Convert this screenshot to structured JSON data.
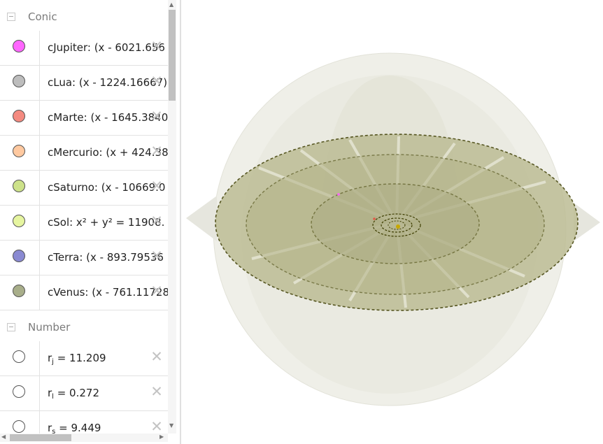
{
  "algebra": {
    "groups": [
      {
        "title": "Conic",
        "items": [
          {
            "text": "cJupiter: (x - 6021.656",
            "color": "#ff66ff"
          },
          {
            "text": "cLua: (x - 1224.16667)",
            "color": "#bdbdbd"
          },
          {
            "text": "cMarte: (x - 1645.3840",
            "color": "#f48a80"
          },
          {
            "text": "cMercurio: (x + 424.38",
            "color": "#ffc9a0"
          },
          {
            "text": "cSaturno: (x - 10669.0",
            "color": "#cde28a"
          },
          {
            "text": "cSol: x² + y² = 11908.",
            "color": "#e6f5a0"
          },
          {
            "text": "cTerra: (x - 893.79536",
            "color": "#8a8ad2"
          },
          {
            "text": "cVenus: (x - 761.11728",
            "color": "#a8ae8a"
          }
        ]
      },
      {
        "title": "Number",
        "items": [
          {
            "name": "r",
            "sub": "j",
            "value": " = 11.209",
            "color": "#ffffff"
          },
          {
            "name": "r",
            "sub": "l",
            "value": " = 0.272",
            "color": "#ffffff"
          },
          {
            "name": "r",
            "sub": "s",
            "value": " = 9.449",
            "color": "#ffffff"
          }
        ]
      }
    ],
    "delete_glyph": "✕",
    "toggle_icon": "minus-square-icon"
  },
  "scrollbars": {
    "up": "▲",
    "down": "▼",
    "left": "◀",
    "right": "▶"
  },
  "colors": {
    "orbit_fill": "#b9b98c",
    "sphere": "#e9e9e0",
    "orbit_line": "#3d3d00",
    "row_border": "#e2e2e2"
  }
}
